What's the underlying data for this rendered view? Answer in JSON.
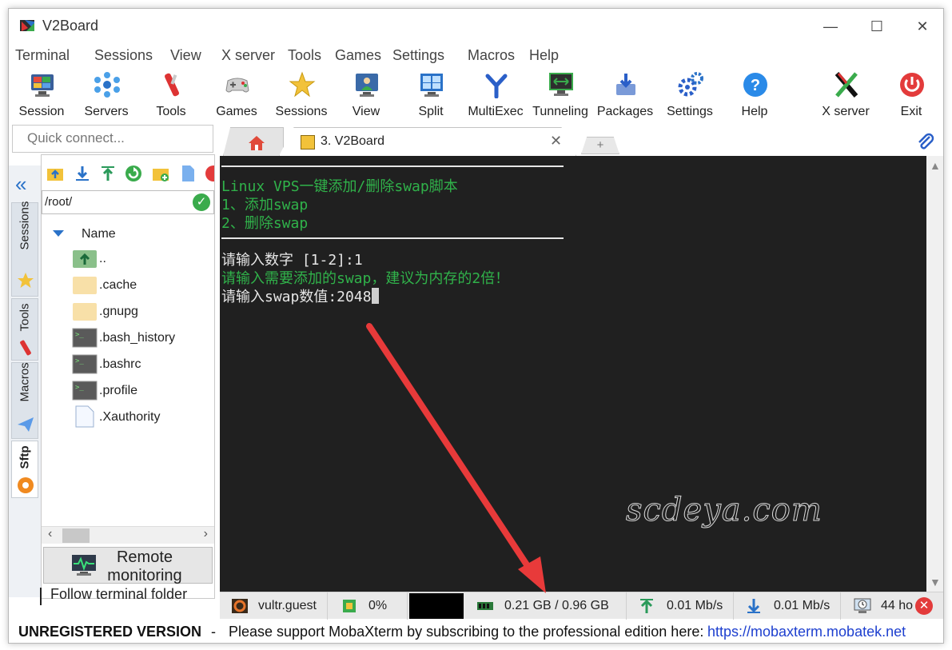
{
  "window": {
    "title": "V2Board"
  },
  "menu": [
    "Terminal",
    "Sessions",
    "View",
    "X server",
    "Tools",
    "Games",
    "Settings",
    "Macros",
    "Help"
  ],
  "toolbar": {
    "session": "Session",
    "servers": "Servers",
    "tools": "Tools",
    "games": "Games",
    "sessions": "Sessions",
    "view": "View",
    "split": "Split",
    "multiexec": "MultiExec",
    "tunneling": "Tunneling",
    "packages": "Packages",
    "settings": "Settings",
    "help": "Help",
    "xserver": "X server",
    "exit": "Exit"
  },
  "quick_connect": {
    "placeholder": "Quick connect..."
  },
  "side_tabs": {
    "sessions": "Sessions",
    "tools": "Tools",
    "macros": "Macros",
    "sftp": "Sftp"
  },
  "sftp": {
    "path": "/root/",
    "column_name": "Name",
    "files": [
      {
        "name": "..",
        "icon": "folder-up-icon"
      },
      {
        "name": ".cache",
        "icon": "folder-icon"
      },
      {
        "name": ".gnupg",
        "icon": "folder-icon"
      },
      {
        "name": ".bash_history",
        "icon": "terminal-file-icon"
      },
      {
        "name": ".bashrc",
        "icon": "terminal-file-icon"
      },
      {
        "name": ".profile",
        "icon": "terminal-file-icon"
      },
      {
        "name": ".Xauthority",
        "icon": "file-icon"
      }
    ],
    "remote_monitoring_line1": "Remote",
    "remote_monitoring_line2": "monitoring",
    "follow_terminal_folder": "Follow terminal folder"
  },
  "tabs": {
    "active_label": "3. V2Board",
    "new_tab": "+"
  },
  "terminal": {
    "lines": [
      "Linux VPS一键添加/删除swap脚本",
      "1、添加swap",
      "2、删除swap",
      "请输入数字 [1-2]:1",
      "请输入需要添加的swap，建议为内存的2倍！",
      "请输入swap数值:2048"
    ],
    "watermark": "scdeya.com"
  },
  "status": {
    "host": "vultr.guest",
    "cpu": "0%",
    "memory": "0.21 GB / 0.96 GB",
    "upload": "0.01 Mb/s",
    "download": "0.01 Mb/s",
    "uptime": "44 ho"
  },
  "footer": {
    "unregistered": "UNREGISTERED VERSION",
    "separator": "-",
    "message": "Please support MobaXterm by subscribing to the professional edition here:",
    "link": "https://mobaxterm.mobatek.net"
  },
  "colors": {
    "terminal_bg": "#202020",
    "terminal_green": "#30b24a",
    "annotation_arrow": "#e83a3a",
    "link": "#1d3fcf"
  }
}
